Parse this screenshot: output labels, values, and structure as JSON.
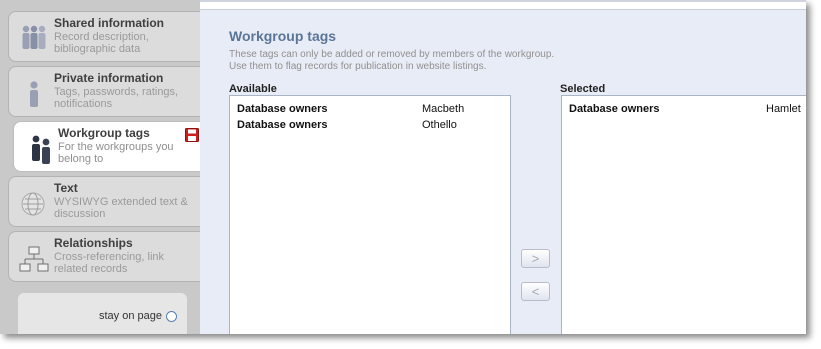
{
  "sidebar": {
    "items": [
      {
        "title": "Shared information",
        "desc": "Record description, bibliographic data",
        "icon": "group-icon"
      },
      {
        "title": "Private information",
        "desc": "Tags, passwords, ratings, notifications",
        "icon": "person-icon"
      },
      {
        "title": "Workgroup tags",
        "desc": "For the workgroups you belong to",
        "icon": "workgroup-icon",
        "active": true
      },
      {
        "title": "Text",
        "desc": "WYSIWYG extended text & discussion",
        "icon": "wikipedia-globe-icon"
      },
      {
        "title": "Relationships",
        "desc": "Cross-referencing, link related records",
        "icon": "hierarchy-icon"
      }
    ],
    "stay_on_page_label": "stay on page"
  },
  "main": {
    "title": "Workgroup tags",
    "intro_line1": "These tags can only be added or removed by members of the workgroup.",
    "intro_line2": "Use them to flag records for publication in website listings.",
    "available_label": "Available",
    "selected_label": "Selected",
    "available": [
      {
        "group": "Database owners",
        "tag": "Macbeth"
      },
      {
        "group": "Database owners",
        "tag": "Othello"
      }
    ],
    "selected": [
      {
        "group": "Database owners",
        "tag": "Hamlet"
      }
    ],
    "add_button": ">",
    "remove_button": "<"
  },
  "colors": {
    "title_blue": "#5b7597",
    "panel_bg": "#e8ecf6",
    "save_red": "#cc1f1f"
  }
}
